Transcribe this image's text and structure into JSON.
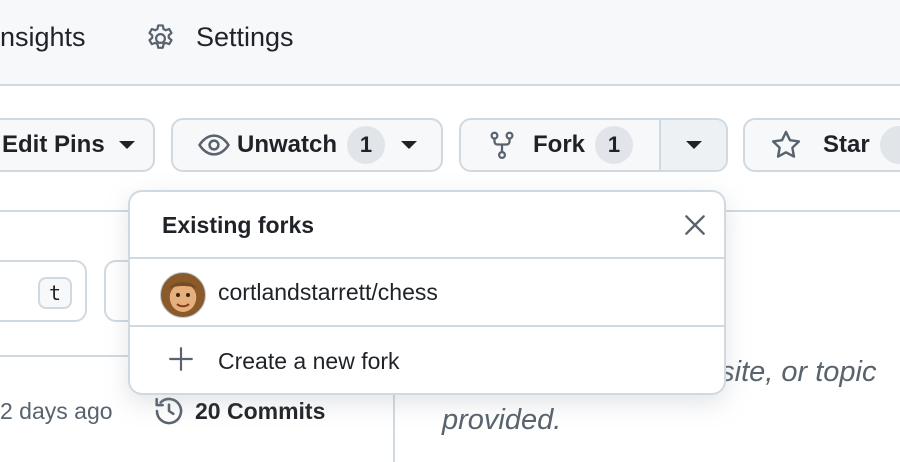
{
  "nav": {
    "tabs": [
      {
        "label": "nsights"
      },
      {
        "label": "Settings",
        "icon": "gear-icon"
      }
    ]
  },
  "actions": {
    "edit_pins": {
      "label": "Edit Pins"
    },
    "unwatch": {
      "label": "Unwatch",
      "count": "1",
      "icon": "eye-icon"
    },
    "fork": {
      "label": "Fork",
      "count": "1",
      "icon": "repo-forked-icon"
    },
    "star": {
      "label": "Star",
      "icon": "star-icon"
    }
  },
  "background": {
    "kbd_key": "t",
    "updated_text": "2 days ago",
    "commits_label": "20 Commits",
    "about_line1": "bsite, or topic",
    "about_line2": "provided."
  },
  "forks_popover": {
    "title": "Existing forks",
    "forks": [
      {
        "name": "cortlandstarrett/chess"
      }
    ],
    "create_label": "Create a new fork"
  },
  "colors": {
    "border": "#d1d9e0",
    "button_bg": "#f6f8fa",
    "text": "#1f2328",
    "muted": "#59636e"
  }
}
